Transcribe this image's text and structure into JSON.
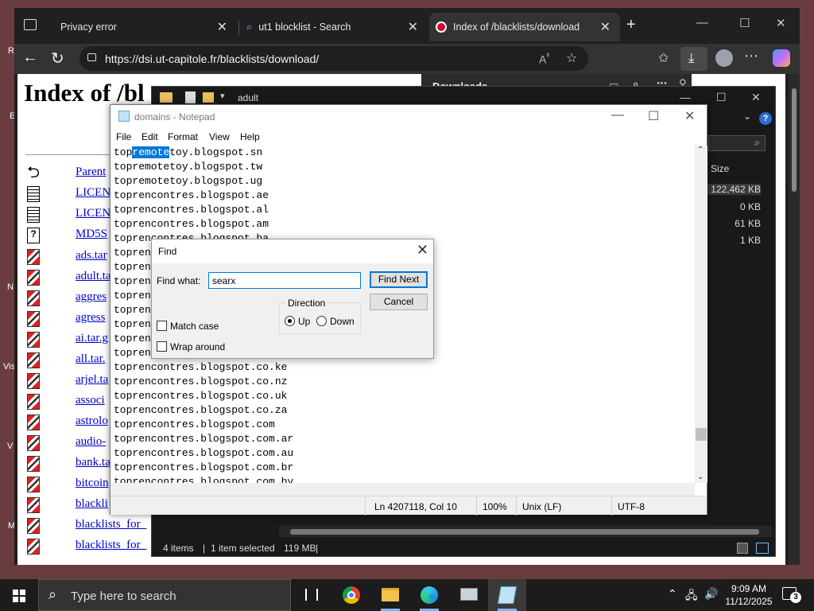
{
  "browser": {
    "tabs": [
      {
        "label": "Privacy error"
      },
      {
        "label": "ut1 blocklist - Search"
      },
      {
        "label": "Index of /blacklists/download"
      }
    ],
    "url": "https://dsi.ut-capitole.fr/blacklists/download/",
    "page_heading": "Index of /bl",
    "downloads_title": "Downloads",
    "links": [
      "Parent",
      "LICEN",
      "LICEN",
      "MD5S",
      "ads.tar",
      "adult.ta",
      "aggres",
      "agress",
      "ai.tar.g",
      "all.tar.",
      "arjel.ta",
      "associ",
      "astrolo",
      "audio-",
      "bank.ta",
      "bitcoin",
      "blackli",
      "blacklists_for_",
      "blacklists_for_"
    ]
  },
  "explorer": {
    "path": "adult",
    "size_header": "Size",
    "sizes": [
      "122,462 KB",
      "0 KB",
      "61 KB",
      "1 KB"
    ],
    "status_items": "4 items",
    "status_selected": "1 item selected",
    "status_size": "119 MB"
  },
  "notepad": {
    "title": "domains - Notepad",
    "menu": [
      "File",
      "Edit",
      "Format",
      "View",
      "Help"
    ],
    "first_line": {
      "pre": "top",
      "highlight": "remote",
      "post": "toy.blogspot.sn"
    },
    "lines": [
      "topremotetoy.blogspot.tw",
      "topremotetoy.blogspot.ug",
      "toprencontres.blogspot.ae",
      "toprencontres.blogspot.al",
      "toprencontres.blogspot.am",
      "toprencontres.blogspot.ba",
      "topren",
      "topren",
      "topren",
      "topren",
      "topren",
      "topren",
      "topren",
      "topren",
      "toprencontres.blogspot.co.ke",
      "toprencontres.blogspot.co.nz",
      "toprencontres.blogspot.co.uk",
      "toprencontres.blogspot.co.za",
      "toprencontres.blogspot.com",
      "toprencontres.blogspot.com.ar",
      "toprencontres.blogspot.com.au",
      "toprencontres.blogspot.com.br",
      "toprencontres.blogspot.com.by"
    ],
    "status": {
      "position": "Ln 4207118, Col 10",
      "zoom": "100%",
      "eol": "Unix (LF)",
      "encoding": "UTF-8"
    }
  },
  "find_dialog": {
    "title": "Find",
    "find_what_label": "Find what:",
    "find_what_value": "searx",
    "find_next": "Find Next",
    "cancel": "Cancel",
    "direction_label": "Direction",
    "up": "Up",
    "down": "Down",
    "match_case": "Match case",
    "wrap_around": "Wrap around"
  },
  "taskbar": {
    "search_placeholder": "Type here to search",
    "time": "9:09 AM",
    "date": "11/12/2025",
    "notifications": "3"
  },
  "desktop_edge": [
    "R",
    "E",
    "N",
    "Vis",
    "V",
    "M"
  ],
  "colors": {
    "accent": "#0078d7",
    "browser_chrome": "#202020",
    "taskbar": "#1c1c1c"
  }
}
